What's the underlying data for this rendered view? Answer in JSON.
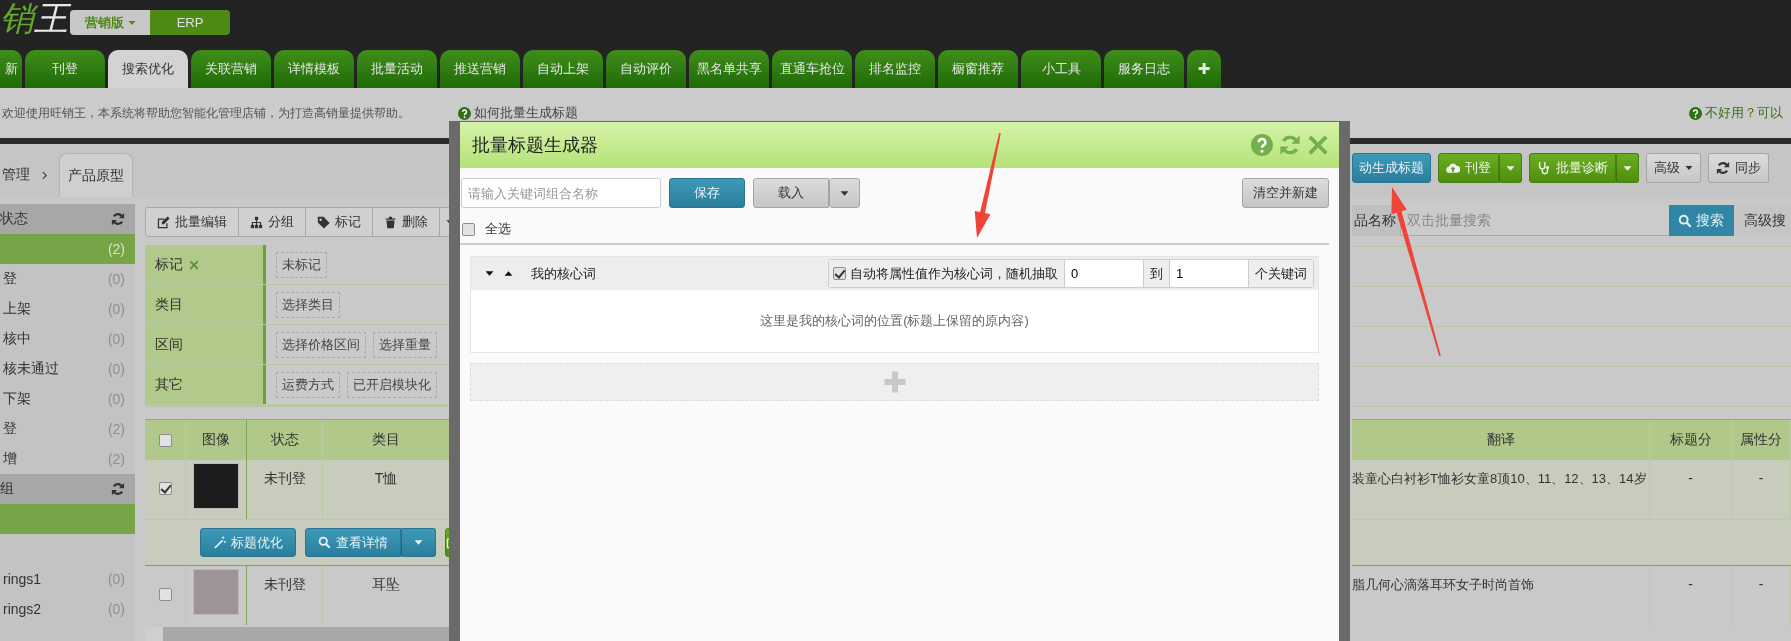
{
  "header": {
    "logo": "销王",
    "editions": [
      {
        "label": "营销版",
        "selected": true,
        "dropdown": true
      },
      {
        "label": "ERP",
        "selected": false,
        "dropdown": false
      }
    ]
  },
  "nav_tabs": [
    {
      "label": "新",
      "kind": "page",
      "selected": false
    },
    {
      "label": "刊登",
      "kind": "page",
      "selected": false
    },
    {
      "label": "搜索优化",
      "kind": "page",
      "selected": true
    },
    {
      "label": "关联营销",
      "kind": "page",
      "selected": false
    },
    {
      "label": "详情模板",
      "kind": "page",
      "selected": false
    },
    {
      "label": "批量活动",
      "kind": "page",
      "selected": false
    },
    {
      "label": "推送营销",
      "kind": "page",
      "selected": false
    },
    {
      "label": "自动上架",
      "kind": "page",
      "selected": false
    },
    {
      "label": "自动评价",
      "kind": "page",
      "selected": false
    },
    {
      "label": "黑名单共享",
      "kind": "page",
      "selected": false
    },
    {
      "label": "直通车抢位",
      "kind": "page",
      "selected": false
    },
    {
      "label": "排名监控",
      "kind": "page",
      "selected": false
    },
    {
      "label": "橱窗推荐",
      "kind": "page",
      "selected": false
    },
    {
      "label": "小工具",
      "kind": "page",
      "selected": false
    },
    {
      "label": "服务日志",
      "kind": "page",
      "selected": false
    },
    {
      "label": "✚",
      "kind": "add",
      "selected": false
    }
  ],
  "notice": {
    "text": "欢迎使用旺销王，本系统将帮助您智能化管理店铺，为打造高销量提供帮助。",
    "help_link": "如何批量生成标题",
    "feedback_link": "不好用？可以"
  },
  "breadcrumb": {
    "parent": "管理",
    "current": "产品原型"
  },
  "actions": [
    {
      "label": "动生成标题",
      "kind": "teal",
      "dropdown": false
    },
    {
      "label": "刊登",
      "kind": "green",
      "dropdown": true
    },
    {
      "label": "批量诊断",
      "kind": "green",
      "dropdown": true
    },
    {
      "label": "高级",
      "kind": "plain",
      "dropdown": true
    },
    {
      "label": "同步",
      "kind": "plain",
      "dropdown": false
    }
  ],
  "sidebar": {
    "sections": [
      {
        "title": "状态",
        "items": [
          {
            "count": "(2)",
            "selected": true
          },
          {
            "label": "登",
            "count": "(0)",
            "selected": false
          },
          {
            "label": "上架",
            "count": "(0)",
            "selected": false
          },
          {
            "label": "核中",
            "count": "(0)",
            "selected": false
          },
          {
            "label": "核未通过",
            "count": "(0)",
            "selected": false
          },
          {
            "label": "下架",
            "count": "(0)",
            "selected": false
          },
          {
            "label": "登",
            "count": "(2)",
            "selected": false
          },
          {
            "label": "增",
            "count": "(2)",
            "selected": false
          }
        ]
      },
      {
        "title": "组",
        "items": [
          {
            "selected": true
          },
          {
            "label": "rings1",
            "count": "(0)",
            "selected": false
          },
          {
            "label": "rings2",
            "count": "(0)",
            "selected": false
          }
        ]
      }
    ]
  },
  "toolbar": {
    "buttons": [
      "批量编辑",
      "分组",
      "标记",
      "删除"
    ],
    "more_dropdown": true
  },
  "filters": [
    {
      "label": "标记",
      "removable": true,
      "options": [
        "未标记"
      ]
    },
    {
      "label": "类目",
      "removable": false,
      "options": [
        "选择类目"
      ]
    },
    {
      "label": "区间",
      "removable": false,
      "options": [
        "选择价格区间",
        "选择重量"
      ]
    },
    {
      "label": "其它",
      "removable": false,
      "options": [
        "运费方式",
        "已开启模块化"
      ]
    }
  ],
  "search": {
    "field": "品名称",
    "placeholder": "双击批量搜索",
    "buttons": [
      "搜索",
      "高级搜"
    ]
  },
  "table": {
    "select_all_checked": false,
    "columns": [
      "图像",
      "状态",
      "类目",
      "翻译",
      "标题分",
      "属性分"
    ],
    "rows": [
      {
        "checked": true,
        "status": "未刊登",
        "category": "T恤",
        "translation": "装童心白衬衫T恤衫女童8顶10、11、12、13、14岁",
        "title_score": "-",
        "attribute_score": "-",
        "actions": [
          "标题优化",
          "查看详情"
        ]
      },
      {
        "checked": false,
        "status": "未刊登",
        "category": "耳坠",
        "translation": "脂几何心滴落耳环女子时尚首饰",
        "title_score": "-",
        "attribute_score": "-"
      }
    ]
  },
  "modal": {
    "title": "批量标题生成器",
    "name_field": {
      "placeholder": "请输入关键词组合名称"
    },
    "save": "保存",
    "load": "载入",
    "clear": "清空并新建",
    "select_all": {
      "label": "全选",
      "checked": false
    },
    "groups": [
      {
        "title": "我的核心词",
        "auto": {
          "checked": true,
          "label": "自动将属性值作为核心词，随机抽取",
          "from": "0",
          "to_label": "到",
          "to": "1",
          "unit": "个关键词"
        },
        "hint": "这里是我的核心词的位置(标题上保留的原内容)"
      }
    ]
  }
}
